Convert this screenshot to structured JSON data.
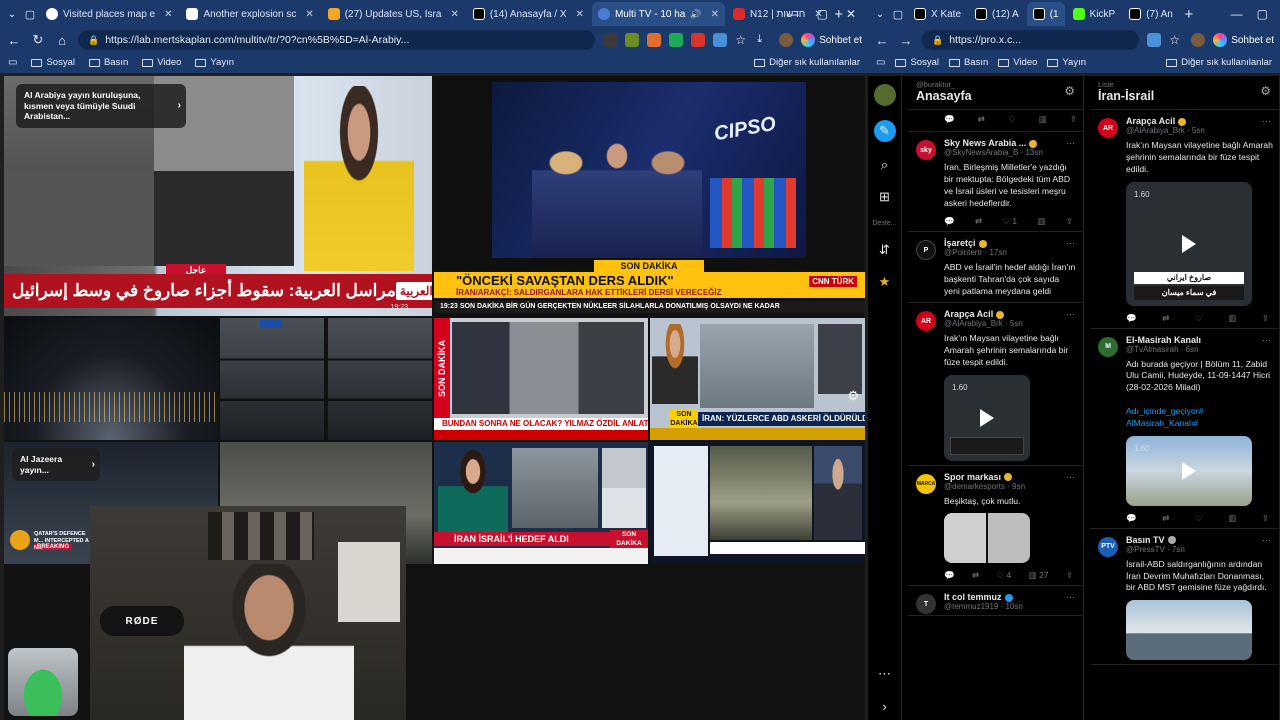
{
  "left_window": {
    "tabs": [
      {
        "label": "Visited places map e",
        "color": "#ffffff"
      },
      {
        "label": "Another explosion sc",
        "color": "#ffffff"
      },
      {
        "label": "(27) Updates US, Isra",
        "color": "#f5a623"
      },
      {
        "label": "(14) Anasayfa / X",
        "color": "#000000"
      },
      {
        "label": "Multi TV - 10 ha",
        "color": "#4c7bd9",
        "active": true
      },
      {
        "label": "N12 | חדשות",
        "color": "#d92b2b"
      }
    ],
    "url": "https://lab.mertskaplan.com/multitv/tr/?0?cn%5B%5D=Al-Arabiy...",
    "copilot_label": "Sohbet et",
    "bookmarks": [
      "Sosyal",
      "Basın",
      "Video",
      "Yayın"
    ],
    "bookmarks_other": "Diğer sık kullanılanlar"
  },
  "tv": {
    "alarabiya_popup": "Al Arabiya yayın kuruluşuna, kısmen veya tümüyle Suudi Arabistan...",
    "alarabiya_urgent": "عاجل",
    "alarabiya_headline": "مراسل العربية: سقوط أجزاء صاروخ في وسط إسرائيل",
    "alarabiya_logo": "العربية",
    "alarabiya_time": "19:23",
    "chips_logo": "CIPSO",
    "cnn_band": "SON DAKİKA",
    "cnn_headline": "\"ÖNCEKİ SAVAŞTAN DERS ALDIK\"",
    "cnn_sub": "İRAN/ARAKÇİ: SALDIRGANLARA HAK ETTİKLERİ DERSİ VERECEĞİZ",
    "cnn_ticker": "19:23  SON DAKİKA  BİR GÜN GERÇEKTEN NÜKLEER SİLAHLARLA DONATILMIŞ OLSAYDI NE KADAR",
    "cnn_logo": "CNN TÜRK",
    "tv1_side": "SON DAKİKA",
    "tv1_headline": "BUNDAN SONRA NE OLACAK? YILMAZ ÖZDİL ANLATIYOR",
    "tv2_tag": "SON DAKİKA",
    "tv2_headline": "İRAN: YÜZLERCE ABD ASKERİ ÖLDÜRÜLDÜ",
    "aljazeera_popup": "Al Jazeera yayın...",
    "aljazeera_breaking": "BREAKING",
    "aljazeera_headline": "QATAR'S DEFENCE M... INTERCEPTED A N...",
    "tv3_headline": "İRAN İSRAİL'İ HEDEF ALDI",
    "tv3_tag": "SON DAKİKA",
    "mic_label": "RØDE"
  },
  "right_window": {
    "tabs": [
      {
        "label": "X Kate",
        "color": "#000000"
      },
      {
        "label": "(12) A",
        "color": "#000000"
      },
      {
        "label": "(1",
        "color": "#000000",
        "active": true
      },
      {
        "label": "KickP",
        "color": "#53fc18"
      },
      {
        "label": "(7) An",
        "color": "#000000"
      }
    ],
    "url": "https://pro.x.c...",
    "copilot_label": "Sohbet et",
    "bookmarks": [
      "Sosyal",
      "Basın",
      "Video",
      "Yayın"
    ],
    "bookmarks_other": "Diğer sık kullanılanlar"
  },
  "twitter": {
    "rail_label": "Deste...",
    "col_a": {
      "sub": "@buraktut_",
      "title": "Anasayfa",
      "tweets": [
        {
          "name": "Sky News Arabia ...",
          "handle": "@SkyNewsArabia_B · 13sn",
          "text": "İran, Birleşmiş Milletler'e yazdığı bir mektupta: Bölgedeki tüm ABD ve İsrail üsleri ve tesisleri meşru askeri hedeflerdir.",
          "avatar": "#c8102e",
          "likes": "1"
        },
        {
          "name": "İşaretçi",
          "handle": "@Pointertr · 17sn",
          "text": "ABD ve İsrail'in hedef aldığı İran'ın başkenti Tahran'da çok sayıda yeni patlama meydana geldi",
          "avatar": "#111111"
        },
        {
          "name": "Arapça Acil",
          "handle": "@AlArabiya_Brk · 5sn",
          "text": "Irak'ın Maysan vilayetine bağlı Amarah şehrinin semalarında bir füze tespit edildi.",
          "avatar": "#d0021b",
          "video": "1.60"
        },
        {
          "name": "Spor markası",
          "handle": "@demarkesports · 9sn",
          "text": "Beşiktaş, çok mutlu.",
          "avatar": "#f5c400",
          "likes": "4",
          "views": "27"
        },
        {
          "name": "It col temmuz",
          "handle": "@temmuz1919 · 10sn",
          "text": "",
          "avatar": "#333333"
        }
      ]
    },
    "col_b": {
      "sub": "Liste",
      "title": "İran-İsrail",
      "tweets": [
        {
          "name": "Arapça Acil",
          "handle": "@AlArabiya_Brk · 5sn",
          "text": "Irak'ın Maysan vilayetine bağlı Amarah şehrinin semalarında bir füze tespit edildi.",
          "avatar": "#d0021b",
          "video": "1.60",
          "caption1": "صاروخ ايراني",
          "caption2": "في سماء ميسان"
        },
        {
          "name": "El-Masirah Kanalı",
          "handle": "@TvAlmasirah · 6sn",
          "text": "Adı burada geçiyor | Bölüm 11, Zabid Ulu Camii, Hudeyde, 11-09-1447 Hicri (28-02-2026 Miladi)",
          "link": "Adı_içinde_geçiyor# AlMasirah_Kanalı#",
          "avatar": "#2b6e2f",
          "video": "1.60"
        },
        {
          "name": "Basın TV",
          "handle": "@PressTV · 7sn",
          "text": "İsrail-ABD saldırganlığının ardından İran Devrim Muhafızları Donanması, bir ABD MST gemisine füze yağdırdı.",
          "avatar": "#1a5fb4"
        }
      ]
    }
  }
}
